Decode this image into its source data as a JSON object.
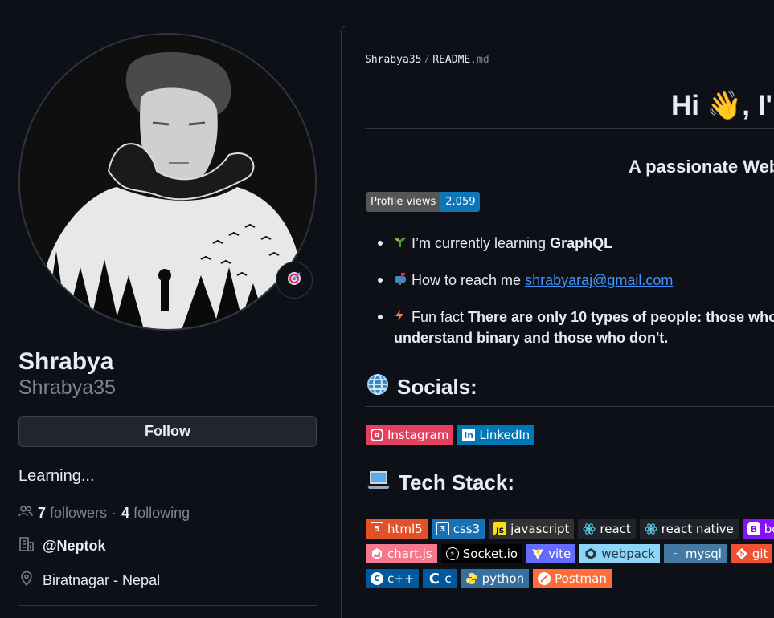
{
  "profile": {
    "name": "Shrabya",
    "login": "Shrabya35",
    "follow_label": "Follow",
    "bio": "Learning...",
    "followers_count": "7",
    "followers_label": "followers",
    "dot": "·",
    "following_count": "4",
    "following_label": "following",
    "org": "@Neptok",
    "location": "Biratnagar - Nepal"
  },
  "readme": {
    "owner": "Shrabya35",
    "separator": "/",
    "file_base": "README",
    "file_ext": ".md",
    "greeting": "Hi 👋, I'",
    "tagline": "A passionate Web",
    "views_label": "Profile views",
    "views_count": "2,059",
    "bullet_learning_pre": "I’m currently learning ",
    "bullet_learning_bold": "GraphQL",
    "bullet_reach_pre": "How to reach me ",
    "bullet_reach_link": "shrabyaraj@gmail.com",
    "bullet_fun_pre": "Fun fact ",
    "bullet_fun_bold": "There are only 10 types of people: those who understand binary and those who don't.",
    "socials_heading": "Socials:",
    "techstack_heading": "Tech Stack:"
  },
  "socials": [
    {
      "label": "Instagram",
      "color": "#e4405f",
      "icon": "instagram-icon"
    },
    {
      "label": "LinkedIn",
      "color": "#0077b5",
      "icon": "linkedin-icon"
    }
  ],
  "tech_row1": [
    {
      "label": "html5",
      "color": "#e34f26",
      "icon": "html5-icon"
    },
    {
      "label": "css3",
      "color": "#1572b6",
      "icon": "css3-icon"
    },
    {
      "label": "javascript",
      "color": "#323330",
      "icon": "javascript-icon"
    },
    {
      "label": "react",
      "color": "#20232a",
      "icon": "react-icon"
    },
    {
      "label": "react native",
      "color": "#20232a",
      "icon": "react-icon"
    },
    {
      "label": "boot",
      "color": "#8511fa",
      "icon": "bootstrap-icon"
    }
  ],
  "tech_row2": [
    {
      "label": "chart.js",
      "color": "#f5788d",
      "icon": "chartjs-icon"
    },
    {
      "label": "Socket.io",
      "color": "#010101",
      "icon": "socketio-icon"
    },
    {
      "label": "vite",
      "color": "#646cff",
      "icon": "vite-icon"
    },
    {
      "label": "webpack",
      "color": "#8dd6f9",
      "icon": "webpack-icon"
    },
    {
      "label": "mysql",
      "color": "#4479a1",
      "icon": "mysql-icon"
    },
    {
      "label": "git",
      "color": "#f05033",
      "icon": "git-icon"
    }
  ],
  "tech_row3": [
    {
      "label": "c++",
      "color": "#00599c",
      "icon": "cpp-icon"
    },
    {
      "label": "c",
      "color": "#00599c",
      "icon": "c-icon"
    },
    {
      "label": "python",
      "color": "#3670a0",
      "icon": "python-icon"
    },
    {
      "label": "Postman",
      "color": "#ff6c37",
      "icon": "postman-icon"
    }
  ]
}
